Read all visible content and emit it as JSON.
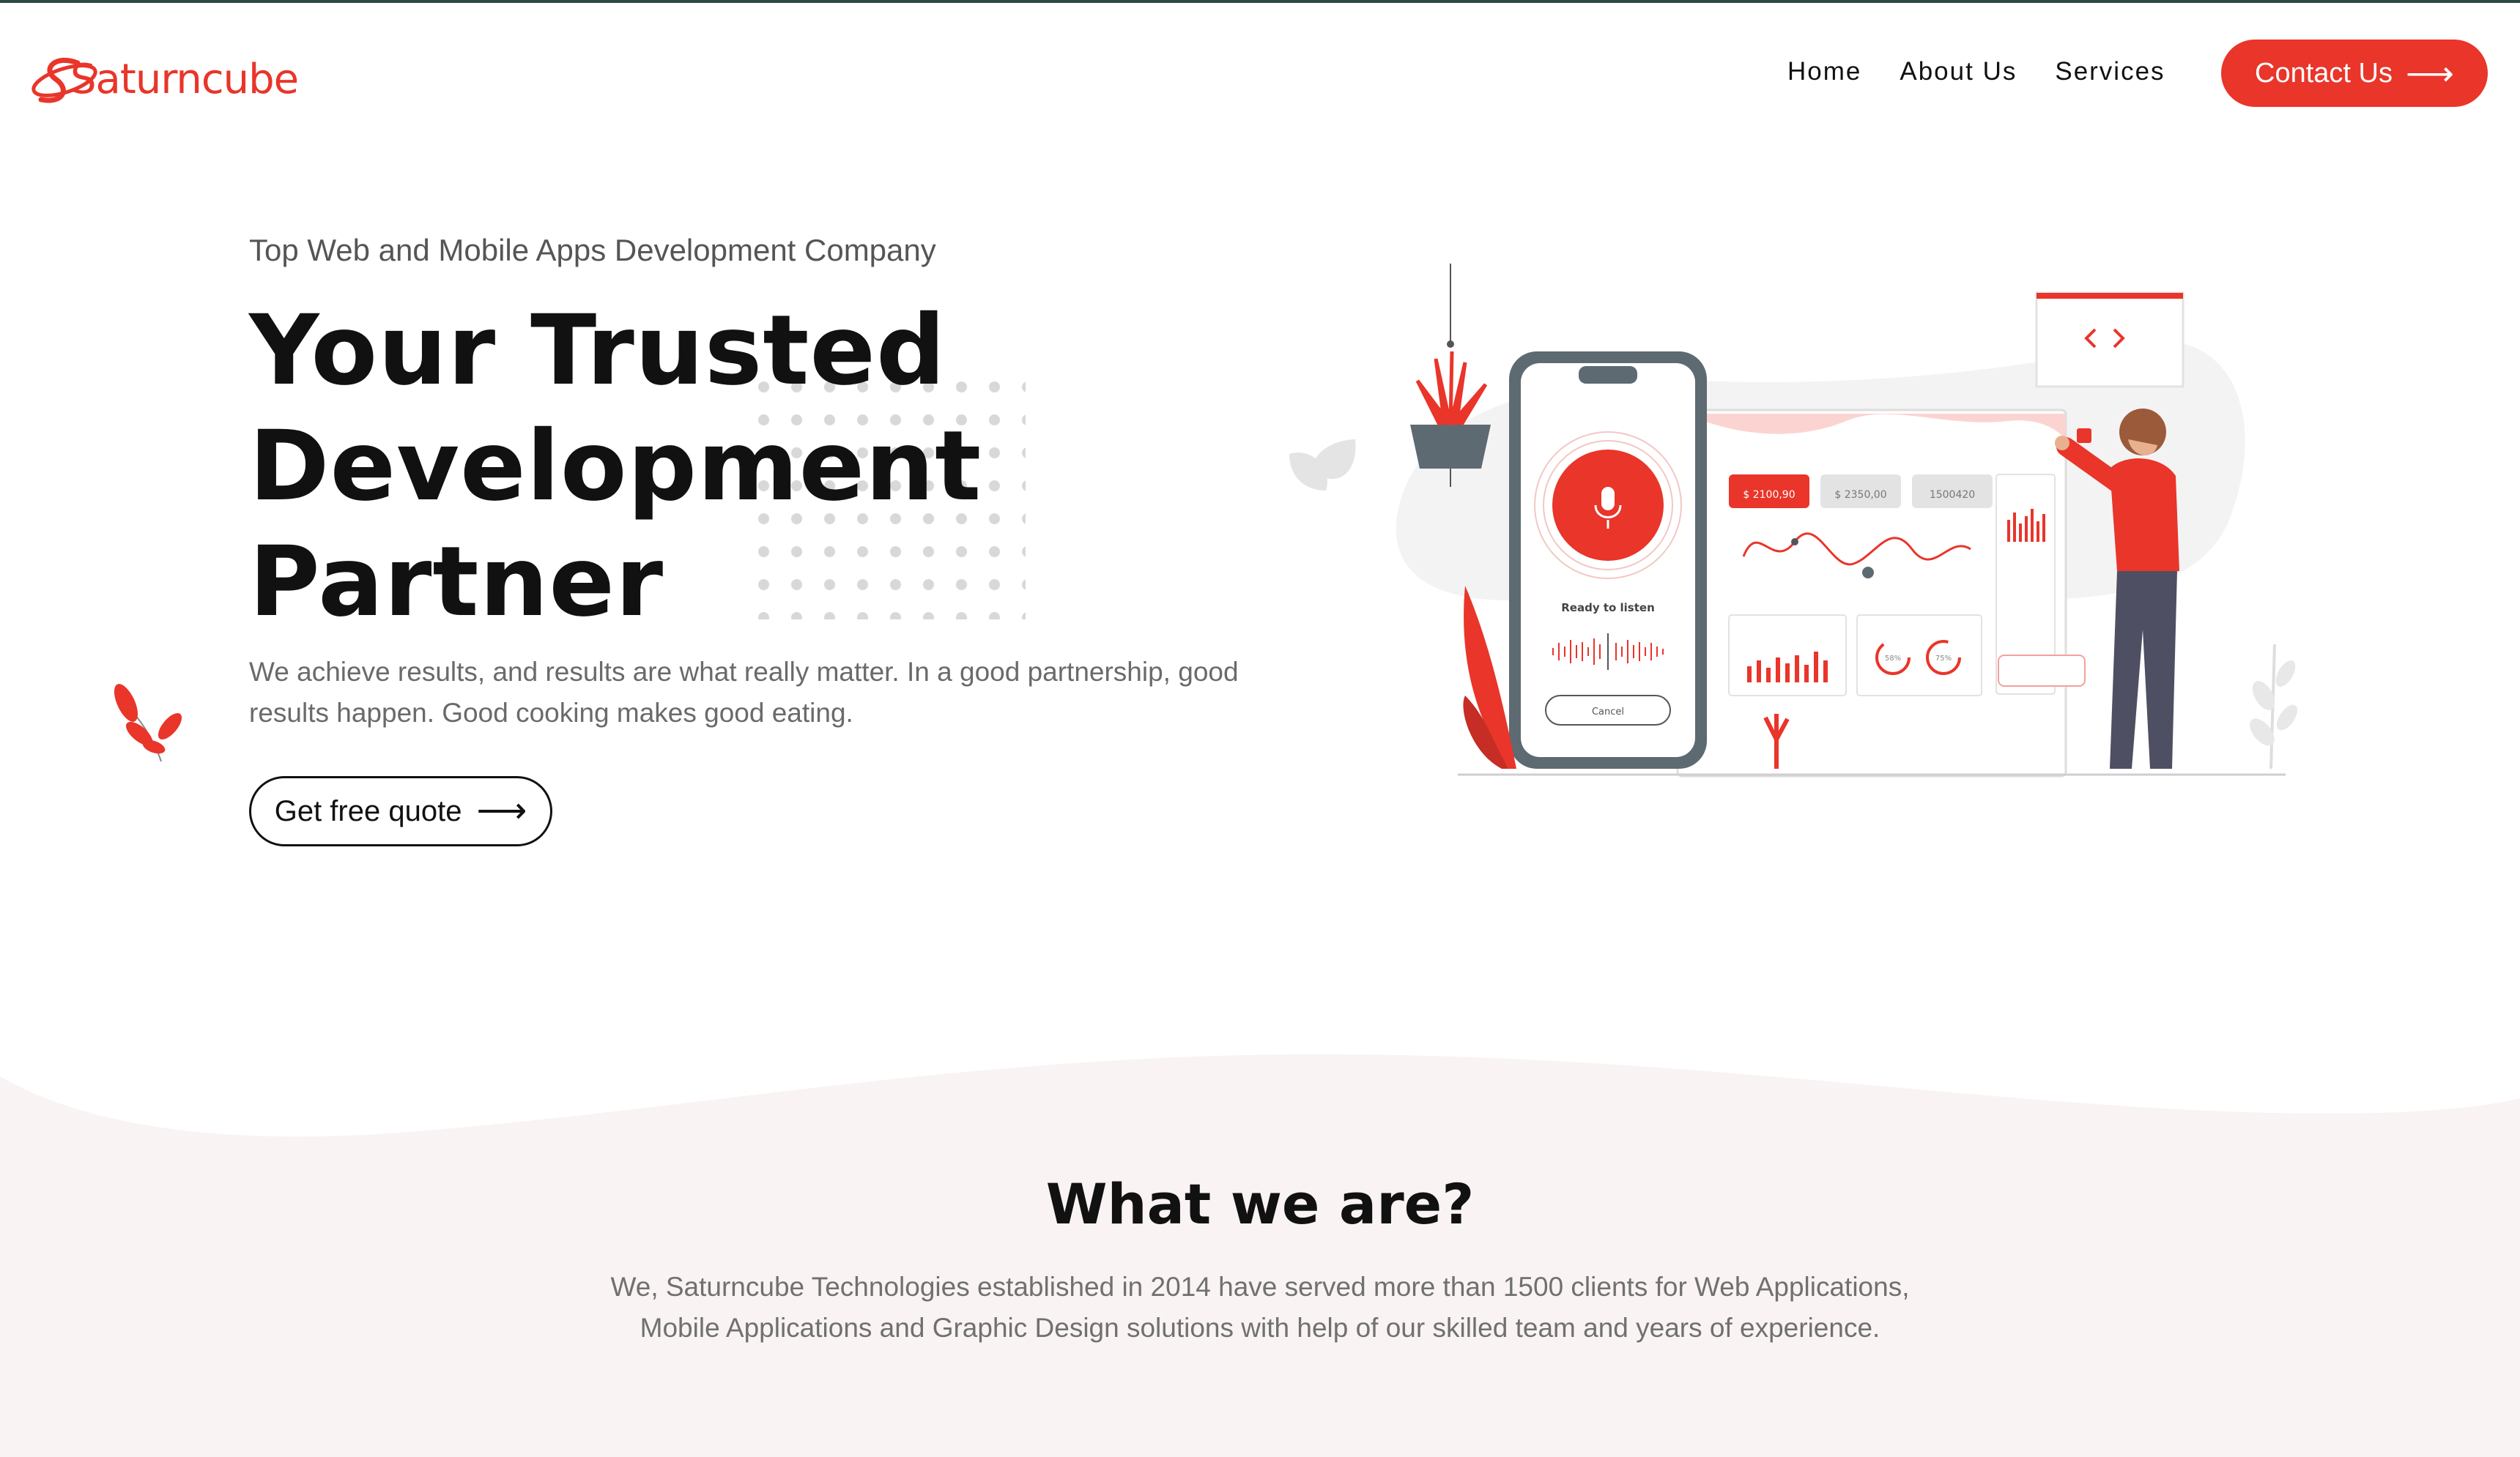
{
  "brand": {
    "logo_text": "Saturncube",
    "accent_color": "#e9352a",
    "dark_color": "#111111"
  },
  "nav": {
    "items": [
      {
        "label": "Home"
      },
      {
        "label": "About Us"
      },
      {
        "label": "Services"
      }
    ],
    "contact_label": "Contact Us",
    "contact_icon": "arrow-right-icon"
  },
  "hero": {
    "tagline": "Top Web and Mobile Apps Development Company",
    "title_lines": [
      "Your Trusted",
      "Development",
      "Partner"
    ],
    "description_line1": "We achieve results, and results are what really matter. In a good partnership, good",
    "description_line2": "results happen. Good cooking makes good eating.",
    "cta_label": "Get free quote",
    "cta_icon": "arrow-right-icon"
  },
  "illustration": {
    "phone_status": "Ready to listen",
    "phone_cancel": "Cancel",
    "stat_1": "$ 2100,90",
    "stat_2": "$ 2350,00",
    "stat_3": "1500420",
    "gauge_1": "58%",
    "gauge_2": "75%"
  },
  "about": {
    "title": "What we are?",
    "description_line1": "We, Saturncube Technologies established in 2014 have served more than 1500 clients for Web Applications,",
    "description_line2": "Mobile Applications and Graphic Design solutions with help of our skilled team and years of experience."
  }
}
